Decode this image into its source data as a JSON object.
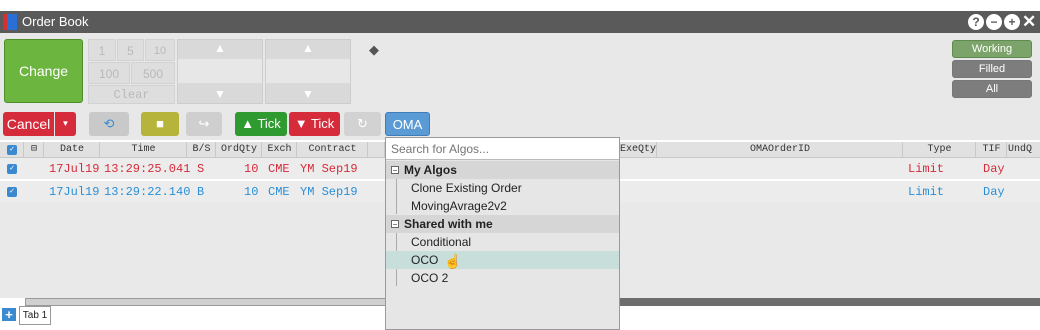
{
  "window": {
    "title": "Order Book"
  },
  "toolbar": {
    "change_label": "Change",
    "qty_row1": [
      "1",
      "5",
      "10"
    ],
    "qty_row2": [
      "100",
      "500"
    ],
    "clear_label": "Clear",
    "status_buttons": [
      "Working",
      "Filled",
      "All"
    ]
  },
  "actions": {
    "cancel_label": "Cancel",
    "tick_up_label": "Tick",
    "tick_down_label": "Tick",
    "oma_label": "OMA"
  },
  "grid": {
    "headers": [
      "Date",
      "Time",
      "B/S",
      "OrdQty",
      "Exch",
      "Contract",
      "ExeQty",
      "OMAOrderID",
      "Type",
      "TIF",
      "UndQ"
    ],
    "rows": [
      {
        "date": "17Jul19",
        "time": "13:29:25.041",
        "bs": "S",
        "qty": "10",
        "exch": "CME",
        "contract": "YM Sep19",
        "type": "Limit",
        "tif": "Day",
        "color": "#d62b3a"
      },
      {
        "date": "17Jul19",
        "time": "13:29:22.140",
        "bs": "B",
        "qty": "10",
        "exch": "CME",
        "contract": "YM Sep19",
        "type": "Limit",
        "tif": "Day",
        "color": "#2a8fd6"
      }
    ]
  },
  "algo_menu": {
    "search_placeholder": "Search for Algos...",
    "groups": [
      {
        "label": "My Algos",
        "items": [
          "Clone Existing Order",
          "MovingAvrage2v2"
        ]
      },
      {
        "label": "Shared with me",
        "items": [
          "Conditional",
          "OCO",
          "OCO 2"
        ]
      }
    ],
    "hovered_item": "OCO"
  },
  "tabs": {
    "items": [
      "Tab 1"
    ]
  },
  "colors": {
    "accent": "#3b8ad0",
    "buy": "#2a8fd6",
    "sell": "#d62b3a",
    "change": "#6cb53f"
  }
}
